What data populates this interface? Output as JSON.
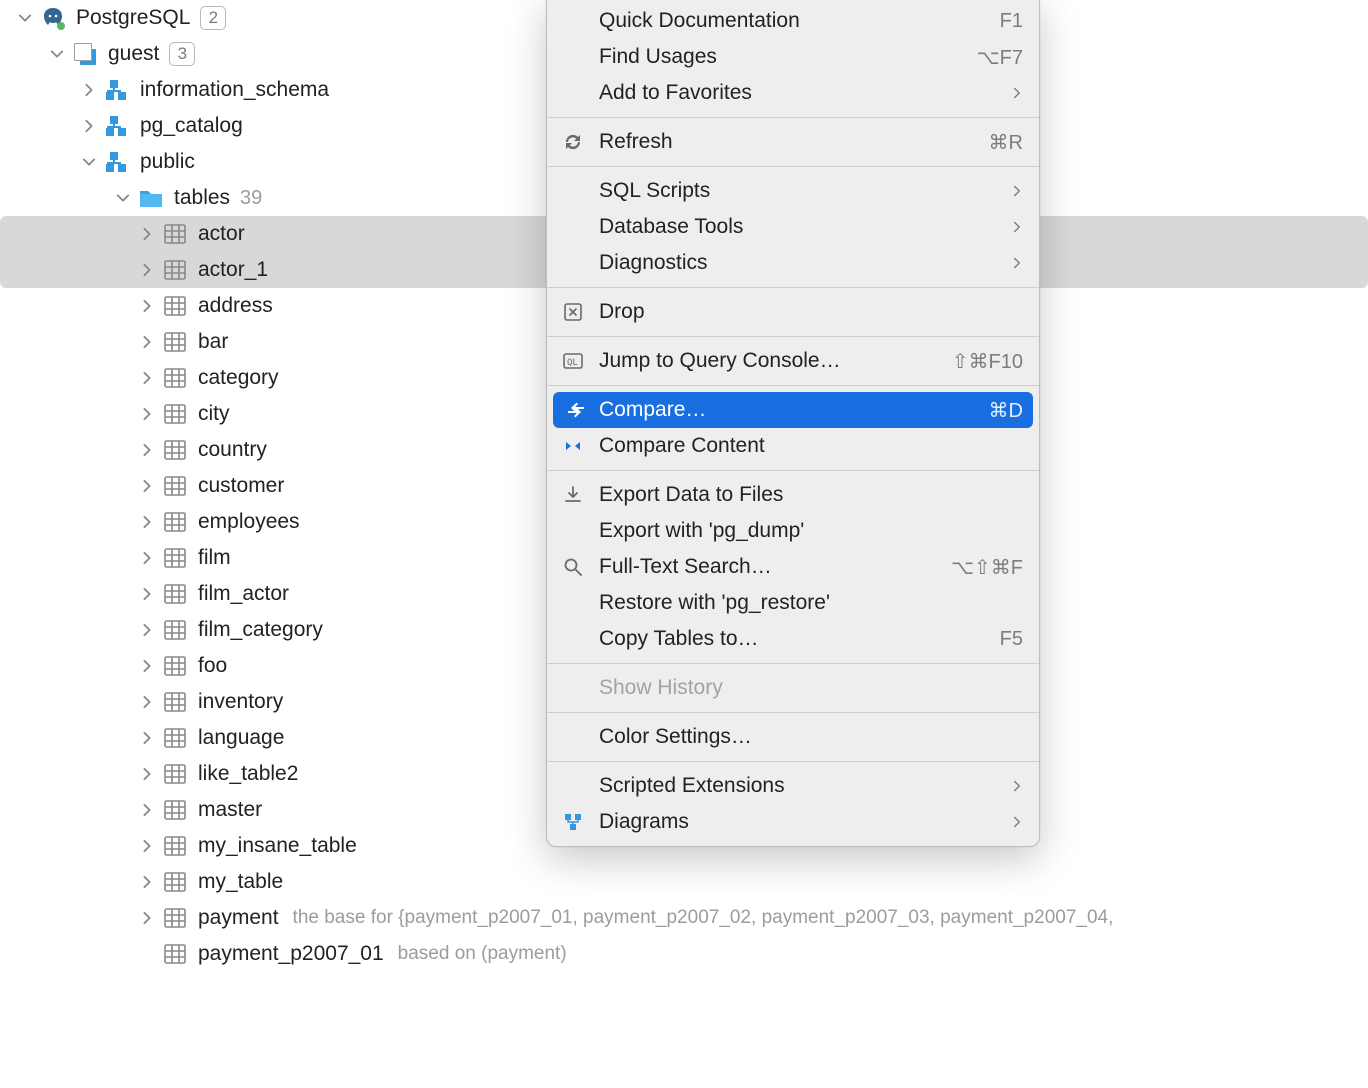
{
  "tree": {
    "root": {
      "label": "PostgreSQL",
      "badge": "2"
    },
    "db": {
      "label": "guest",
      "badge": "3"
    },
    "schemas": {
      "info": "information_schema",
      "pgcat": "pg_catalog",
      "public": "public"
    },
    "tablesFolder": {
      "label": "tables",
      "count": "39"
    },
    "tables": [
      "actor",
      "actor_1",
      "address",
      "bar",
      "category",
      "city",
      "country",
      "customer",
      "employees",
      "film",
      "film_actor",
      "film_category",
      "foo",
      "inventory",
      "language",
      "like_table2",
      "master",
      "my_insane_table",
      "my_table",
      "payment",
      "payment_p2007_01"
    ],
    "notes": {
      "payment": "the base for {payment_p2007_01, payment_p2007_02, payment_p2007_03, payment_p2007_04,",
      "payment_p2007_01": "based on (payment)"
    }
  },
  "menu": [
    {
      "id": "quick-doc",
      "label": "Quick Documentation",
      "shortcut": "F1"
    },
    {
      "id": "find-usages",
      "label": "Find Usages",
      "shortcut": "⌥F7"
    },
    {
      "id": "add-fav",
      "label": "Add to Favorites",
      "submenu": true
    },
    {
      "sep": true
    },
    {
      "id": "refresh",
      "label": "Refresh",
      "shortcut": "⌘R",
      "icon": "refresh"
    },
    {
      "sep": true
    },
    {
      "id": "sql-scripts",
      "label": "SQL Scripts",
      "submenu": true
    },
    {
      "id": "db-tools",
      "label": "Database Tools",
      "submenu": true
    },
    {
      "id": "diagnostics",
      "label": "Diagnostics",
      "submenu": true
    },
    {
      "sep": true
    },
    {
      "id": "drop",
      "label": "Drop",
      "icon": "delete"
    },
    {
      "sep": true
    },
    {
      "id": "jump-console",
      "label": "Jump to Query Console…",
      "shortcut": "⇧⌘F10",
      "icon": "console"
    },
    {
      "sep": true
    },
    {
      "id": "compare",
      "label": "Compare…",
      "shortcut": "⌘D",
      "icon": "compare",
      "selected": true
    },
    {
      "id": "compare-content",
      "label": "Compare Content",
      "icon": "compare2"
    },
    {
      "sep": true
    },
    {
      "id": "export",
      "label": "Export Data to Files",
      "icon": "export"
    },
    {
      "id": "export-pgdump",
      "label": "Export with 'pg_dump'"
    },
    {
      "id": "fulltext",
      "label": "Full-Text Search…",
      "shortcut": "⌥⇧⌘F",
      "icon": "search"
    },
    {
      "id": "restore",
      "label": "Restore with 'pg_restore'"
    },
    {
      "id": "copy-tables",
      "label": "Copy Tables to…",
      "shortcut": "F5"
    },
    {
      "sep": true
    },
    {
      "id": "show-history",
      "label": "Show History",
      "disabled": true
    },
    {
      "sep": true
    },
    {
      "id": "color-settings",
      "label": "Color Settings…"
    },
    {
      "sep": true
    },
    {
      "id": "scripted-ext",
      "label": "Scripted Extensions",
      "submenu": true
    },
    {
      "id": "diagrams",
      "label": "Diagrams",
      "submenu": true,
      "icon": "diagram"
    }
  ]
}
